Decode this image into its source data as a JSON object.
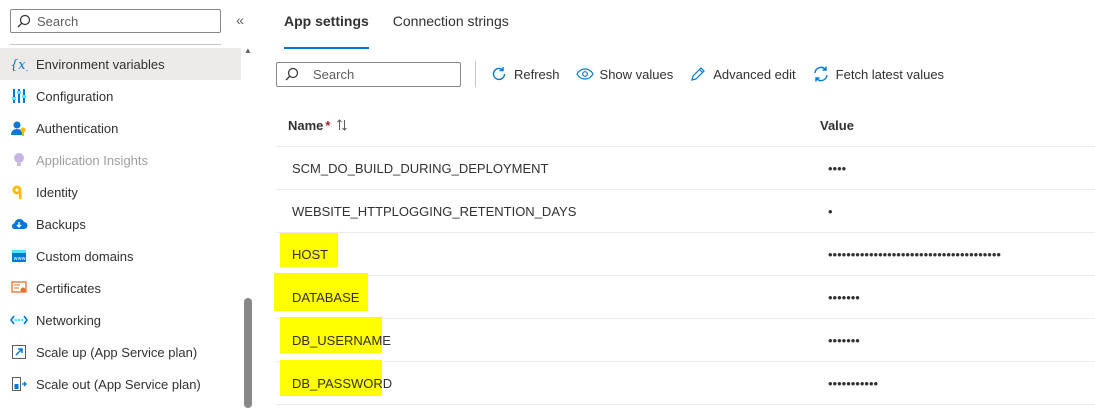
{
  "sidebar": {
    "search_placeholder": "Search",
    "collapse_glyph": "«",
    "items": [
      {
        "label": "Environment variables",
        "icon": "environment-variables-icon",
        "selected": true
      },
      {
        "label": "Configuration",
        "icon": "configuration-icon"
      },
      {
        "label": "Authentication",
        "icon": "authentication-icon"
      },
      {
        "label": "Application Insights",
        "icon": "application-insights-icon",
        "disabled": true
      },
      {
        "label": "Identity",
        "icon": "identity-icon"
      },
      {
        "label": "Backups",
        "icon": "backups-icon"
      },
      {
        "label": "Custom domains",
        "icon": "custom-domains-icon"
      },
      {
        "label": "Certificates",
        "icon": "certificates-icon"
      },
      {
        "label": "Networking",
        "icon": "networking-icon"
      },
      {
        "label": "Scale up (App Service plan)",
        "icon": "scale-up-icon"
      },
      {
        "label": "Scale out (App Service plan)",
        "icon": "scale-out-icon"
      }
    ]
  },
  "tabs": [
    {
      "label": "App settings",
      "active": true
    },
    {
      "label": "Connection strings"
    }
  ],
  "toolbar": {
    "search_placeholder": "Search",
    "refresh": "Refresh",
    "show_values": "Show values",
    "advanced_edit": "Advanced edit",
    "fetch_latest": "Fetch latest values"
  },
  "grid": {
    "col_name": "Name",
    "required_mark": "*",
    "col_value": "Value",
    "rows": [
      {
        "name": "SCM_DO_BUILD_DURING_DEPLOYMENT",
        "value": "••••",
        "highlighted": false
      },
      {
        "name": "WEBSITE_HTTPLOGGING_RETENTION_DAYS",
        "value": "•",
        "highlighted": false
      },
      {
        "name": "HOST",
        "value": "••••••••••••••••••••••••••••••••••••••",
        "highlighted": true
      },
      {
        "name": "DATABASE",
        "value": "•••••••",
        "highlighted": true
      },
      {
        "name": "DB_USERNAME",
        "value": "•••••••",
        "highlighted": true
      },
      {
        "name": "DB_PASSWORD",
        "value": "•••••••••••",
        "highlighted": true
      }
    ]
  },
  "colors": {
    "accent": "#0078d4",
    "highlight": "#ffff00",
    "selected_bg": "#edebe9",
    "required": "#a4262c"
  }
}
